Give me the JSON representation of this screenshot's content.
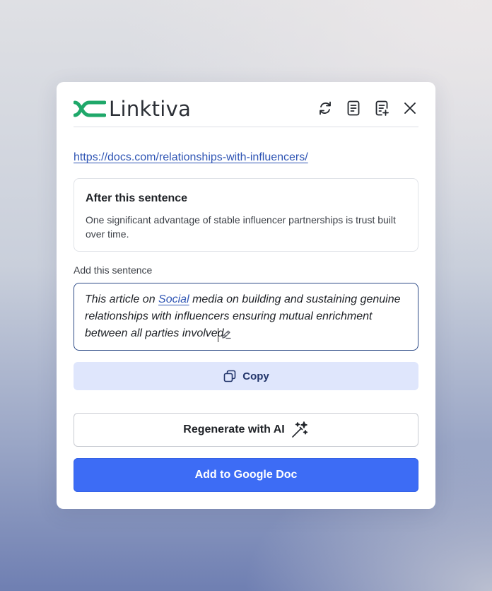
{
  "brand": {
    "name": "Linktiva",
    "mark_color": "#1fa86a"
  },
  "header": {
    "icons": [
      "refresh-icon",
      "document-icon",
      "document-add-icon",
      "close-icon"
    ]
  },
  "source_url": "https://docs.com/relationships-with-influencers/",
  "after": {
    "title": "After this sentence",
    "text": "One significant advantage of stable influencer partnerships is trust built over time."
  },
  "add_section": {
    "label": "Add this sentence",
    "text_before": "This article on ",
    "link_text": "Social",
    "text_after": " media on building and sustaining genuine relationships with influencers ensuring mutual enrichment between all parties involved."
  },
  "buttons": {
    "copy": "Copy",
    "regenerate": "Regenerate with AI",
    "add_to_doc": "Add to Google Doc"
  },
  "colors": {
    "accent": "#3d6cf5",
    "link": "#2f55b4",
    "copy_bg": "#dfe6fc",
    "input_border": "#2c4a86"
  }
}
